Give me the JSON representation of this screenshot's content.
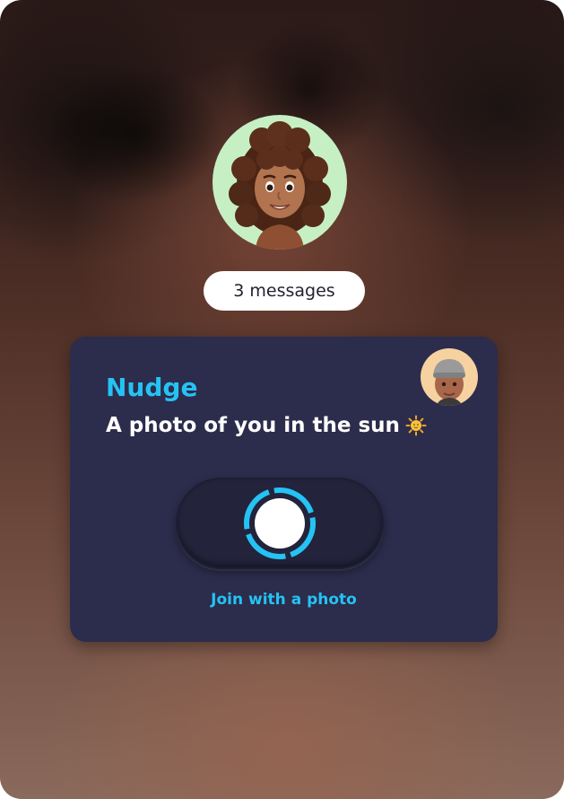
{
  "messages_badge": {
    "label": "3 messages"
  },
  "card": {
    "title": "Nudge",
    "prompt": "A photo of you in the sun",
    "prompt_icon": "sun-emoji",
    "join_label": "Join with a photo"
  },
  "icons": {
    "main_avatar": "memoji-curly-hair-avatar",
    "sender_avatar": "memoji-beanie-avatar",
    "capture": "shutter-button-icon"
  },
  "colors": {
    "accent": "#25c3f3",
    "card_background": "#2c2c4c",
    "main_avatar_bg": "#c6f0c3",
    "sender_avatar_bg": "#f6d2a0"
  }
}
